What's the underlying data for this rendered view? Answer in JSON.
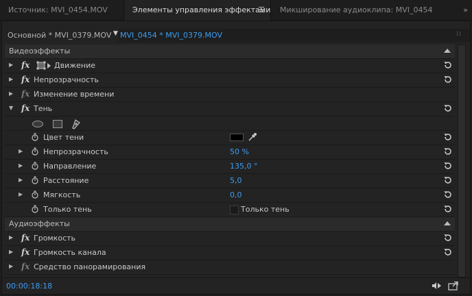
{
  "tabs": [
    {
      "label": "Источник: MVI_0454.MOV",
      "active": false
    },
    {
      "label": "Элементы управления эффектами",
      "active": true
    },
    {
      "label": "Микширование аудиоклипа: MVI_0454",
      "active": false
    }
  ],
  "tab_menu_icon": "hamburger-icon",
  "tab_overflow": "»",
  "clip": {
    "master": "Основной * MVI_0379.MOV",
    "sequence": "MVI_0454 * MVI_0379.MOV"
  },
  "sections": {
    "video": "Видеоэффекты",
    "audio": "Аудиоэффекты"
  },
  "fx_label": "fx",
  "video_effects": [
    {
      "label": "Движение"
    },
    {
      "label": "Непрозрачность"
    },
    {
      "label": "Изменение времени"
    },
    {
      "label": "Тень"
    }
  ],
  "shadow_params": [
    {
      "label": "Цвет тени"
    },
    {
      "label": "Непрозрачность",
      "value": "50 %"
    },
    {
      "label": "Направление",
      "value": "135,0 °"
    },
    {
      "label": "Расстояние",
      "value": "5,0"
    },
    {
      "label": "Мягкость",
      "value": "0,0"
    },
    {
      "label": "Только тень",
      "checkbox_label": "Только тень",
      "checked": false
    }
  ],
  "shadow_color": "#000000",
  "audio_effects": [
    {
      "label": "Громкость"
    },
    {
      "label": "Громкость канала"
    },
    {
      "label": "Средство панорамирования"
    }
  ],
  "footer": {
    "timecode": "00:00:18:18"
  },
  "colors": {
    "accent": "#3d9df2",
    "panel": "#232323",
    "background": "#1d1d1d"
  }
}
